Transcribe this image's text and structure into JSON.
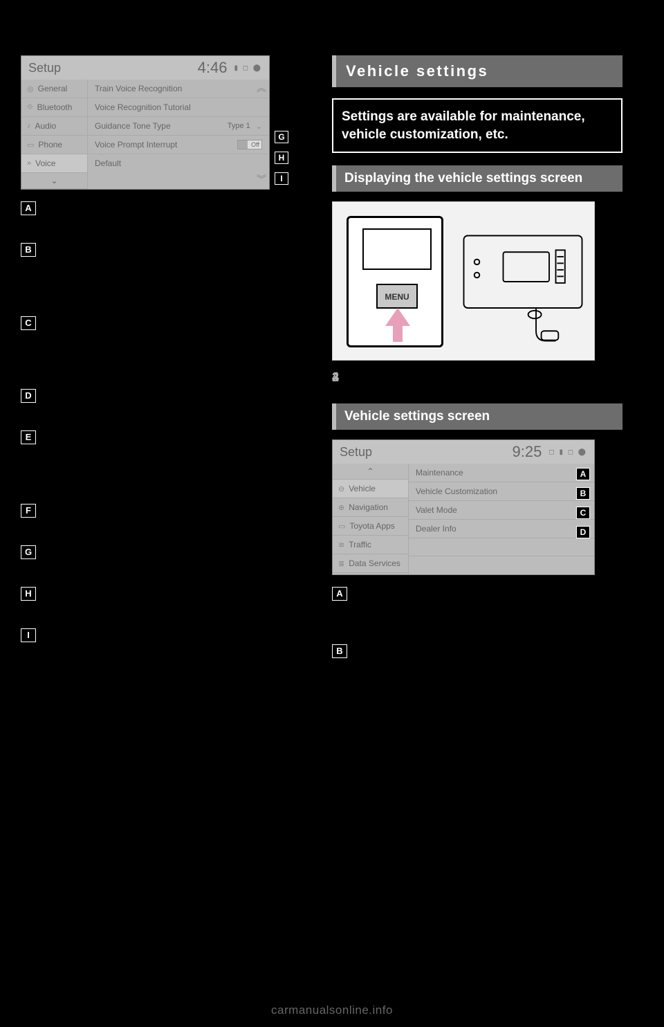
{
  "setup1": {
    "title": "Setup",
    "time": "4:46",
    "status": "▮ ◻ ⬤",
    "sidebar": {
      "items": [
        "General",
        "Bluetooth",
        "Audio",
        "Phone",
        "Voice"
      ],
      "icons": [
        "◎",
        "⟐",
        "♪",
        "▭",
        "»"
      ]
    },
    "rows": {
      "r0": "Train Voice Recognition",
      "r1": "Voice Recognition Tutorial",
      "r2_label": "Guidance Tone Type",
      "r2_value": "Type 1",
      "r3_label": "Voice Prompt Interrupt",
      "r3_value": "Off",
      "r4": "Default"
    },
    "callouts": {
      "g": "G",
      "h": "H",
      "i": "I"
    }
  },
  "left_descriptions": {
    "A": "",
    "B": "",
    "C": "",
    "D": "",
    "E": "",
    "F": "",
    "G": "",
    "H": "",
    "I": ""
  },
  "right": {
    "section_title": "Vehicle settings",
    "intro": "Settings are available for maintenance, vehicle cus­tomization, etc.",
    "sub_title": "Displaying the vehicle settings screen",
    "steps": {
      "s1": "",
      "s2": "",
      "s3": "",
      "s4": ""
    },
    "menu_label": "MENU",
    "sub_title2": "Vehicle settings screen"
  },
  "setup2": {
    "title": "Setup",
    "time": "9:25",
    "status": "◻ ▮ ◻ ⬤",
    "sidebar": {
      "items": [
        "Vehicle",
        "Navigation",
        "Toyota Apps",
        "Traffic",
        "Data Services"
      ],
      "icons": [
        "⊖",
        "⊕",
        "▭",
        "≋",
        "≣"
      ]
    },
    "rows": {
      "r0": "Maintenance",
      "r1": "Vehicle Customization",
      "r2": "Valet Mode",
      "r3": "Dealer Info"
    },
    "callouts": {
      "a": "A",
      "b": "B",
      "c": "C",
      "d": "D"
    }
  },
  "right_descriptions": {
    "A": "",
    "B": ""
  },
  "watermark": "carmanualsonline.info"
}
